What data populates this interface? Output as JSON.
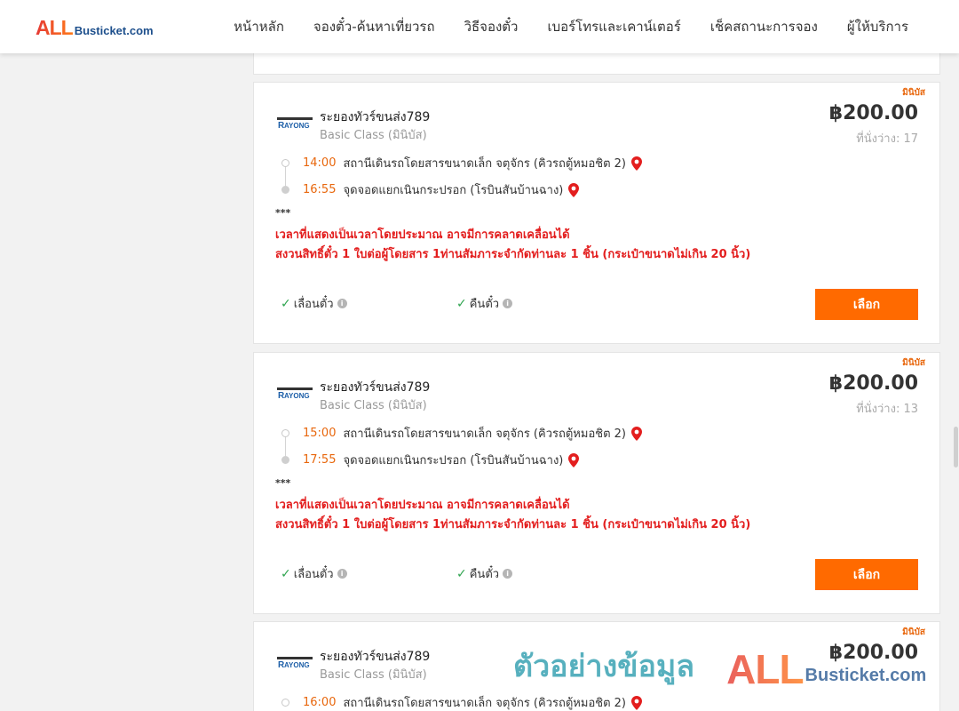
{
  "header": {
    "logo_big": "ALL",
    "logo_small": "Busticket.com",
    "nav": [
      {
        "label": "หน้าหลัก"
      },
      {
        "label": "จองตั๋ว-ค้นหาเที่ยวรถ"
      },
      {
        "label": "วิธีจองตั๋ว"
      },
      {
        "label": "เบอร์โทรและเคาน์เตอร์"
      },
      {
        "label": "เช็คสถานะการจอง"
      },
      {
        "label": "ผู้ให้บริการ"
      }
    ]
  },
  "trips": [
    {
      "badge": "มินิบัส",
      "operator": "ระยองทัวร์ขนส่ง789",
      "bus_class": "Basic Class (มินิบัส)",
      "price": "฿200.00",
      "seats": "ที่นั่งว่าง: 17",
      "depart_time": "14:00",
      "depart_place": "สถานีเดินรถโดยสารขนาดเล็ก จตุจักร (คิวรถตู้หมอชิต 2)",
      "arrive_time": "16:55",
      "arrive_place": "จุดจอดแยกเนินกระปรอก (โรบินสันบ้านฉาง)",
      "stars": "***",
      "note1": "เวลาที่แสดงเป็นเวลาโดยประมาณ อาจมีการคลาดเคลื่อนได้",
      "note2": "สงวนสิทธิ์ตั๋ว 1 ใบต่อผู้โดยสาร 1ท่านสัมภาระจำกัดท่านละ 1 ชิ้น (กระเป๋าขนาดไม่เกิน 20 นิ้ว)",
      "feature1": "เลื่อนตั๋ว",
      "feature2": "คืนตั๋ว",
      "button": "เลือก"
    },
    {
      "badge": "มินิบัส",
      "operator": "ระยองทัวร์ขนส่ง789",
      "bus_class": "Basic Class (มินิบัส)",
      "price": "฿200.00",
      "seats": "ที่นั่งว่าง: 13",
      "depart_time": "15:00",
      "depart_place": "สถานีเดินรถโดยสารขนาดเล็ก จตุจักร (คิวรถตู้หมอชิต 2)",
      "arrive_time": "17:55",
      "arrive_place": "จุดจอดแยกเนินกระปรอก (โรบินสันบ้านฉาง)",
      "stars": "***",
      "note1": "เวลาที่แสดงเป็นเวลาโดยประมาณ อาจมีการคลาดเคลื่อนได้",
      "note2": "สงวนสิทธิ์ตั๋ว 1 ใบต่อผู้โดยสาร 1ท่านสัมภาระจำกัดท่านละ 1 ชิ้น (กระเป๋าขนาดไม่เกิน 20 นิ้ว)",
      "feature1": "เลื่อนตั๋ว",
      "feature2": "คืนตั๋ว",
      "button": "เลือก"
    },
    {
      "badge": "มินิบัส",
      "operator": "ระยองทัวร์ขนส่ง789",
      "bus_class": "Basic Class (มินิบัส)",
      "price": "฿200.00",
      "depart_time": "16:00",
      "depart_place": "สถานีเดินรถโดยสารขนาดเล็ก จตุจักร (คิวรถตู้หมอชิต 2)"
    }
  ],
  "watermark": {
    "text": "ตัวอย่างข้อมูล",
    "logo_big": "ALL",
    "logo_small": "Busticket.com"
  },
  "colors": {
    "accent": "#ff6a00",
    "time": "#e8670d",
    "warning": "#e31e1e",
    "check": "#2ea44f"
  }
}
